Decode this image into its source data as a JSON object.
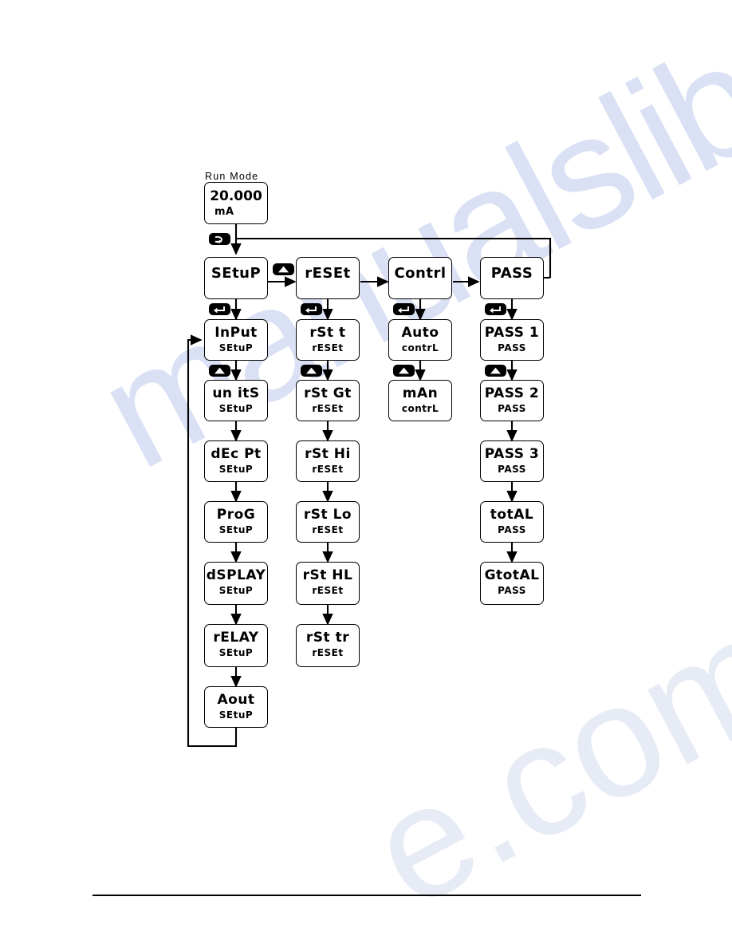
{
  "page": {
    "run_mode_caption": "Run Mode",
    "watermark": "manualslib",
    "watermark_fragment": "e.com"
  },
  "run_mode": {
    "value": "20.000",
    "units": "mA"
  },
  "keys": {
    "loop": "loop-key",
    "enter": "enter-key",
    "up": "up-arrow-key"
  },
  "menus": [
    {
      "id": "setup",
      "head": "SEtuP",
      "items": [
        {
          "line1": "InPut",
          "line2": "SEtuP"
        },
        {
          "line1": "un itS",
          "line2": "SEtuP"
        },
        {
          "line1": "dEc Pt",
          "line2": "SEtuP"
        },
        {
          "line1": "ProG",
          "line2": "SEtuP"
        },
        {
          "line1": "dSPLAY",
          "line2": "SEtuP"
        },
        {
          "line1": "rELAY",
          "line2": "SEtuP"
        },
        {
          "line1": "Aout",
          "line2": "SEtuP"
        }
      ]
    },
    {
      "id": "reset",
      "head": "rESEt",
      "items": [
        {
          "line1": "rSt t",
          "line2": "rESEt"
        },
        {
          "line1": "rSt Gt",
          "line2": "rESEt"
        },
        {
          "line1": "rSt Hi",
          "line2": "rESEt"
        },
        {
          "line1": "rSt Lo",
          "line2": "rESEt"
        },
        {
          "line1": "rSt HL",
          "line2": "rESEt"
        },
        {
          "line1": "rSt tr",
          "line2": "rESEt"
        }
      ]
    },
    {
      "id": "contrl",
      "head": "Contrl",
      "items": [
        {
          "line1": "Auto",
          "line2": "contrL"
        },
        {
          "line1": "mAn",
          "line2": "contrL"
        }
      ]
    },
    {
      "id": "pass",
      "head": "PASS",
      "items": [
        {
          "line1": "PASS 1",
          "line2": "PASS"
        },
        {
          "line1": "PASS 2",
          "line2": "PASS"
        },
        {
          "line1": "PASS 3",
          "line2": "PASS"
        },
        {
          "line1": "totAL",
          "line2": "PASS"
        },
        {
          "line1": "GtotAL",
          "line2": "PASS"
        }
      ]
    }
  ]
}
